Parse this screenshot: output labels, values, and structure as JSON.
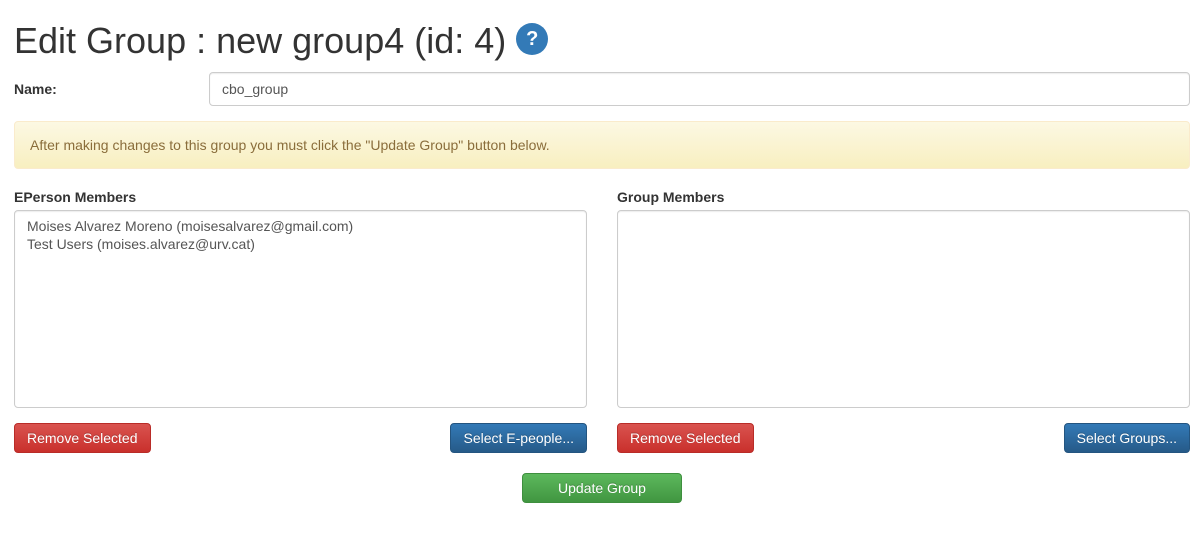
{
  "heading": "Edit Group : new group4 (id: 4)",
  "helpIconLabel": "?",
  "nameLabel": "Name:",
  "nameValue": "cbo_group",
  "alertText": "After making changes to this group you must click the \"Update Group\" button below.",
  "eperson": {
    "label": "EPerson Members",
    "members": [
      "Moises Alvarez Moreno (moisesalvarez@gmail.com)",
      "Test Users (moises.alvarez@urv.cat)"
    ],
    "removeLabel": "Remove Selected",
    "selectLabel": "Select E-people..."
  },
  "group": {
    "label": "Group Members",
    "members": [],
    "removeLabel": "Remove Selected",
    "selectLabel": "Select Groups..."
  },
  "updateLabel": "Update Group"
}
